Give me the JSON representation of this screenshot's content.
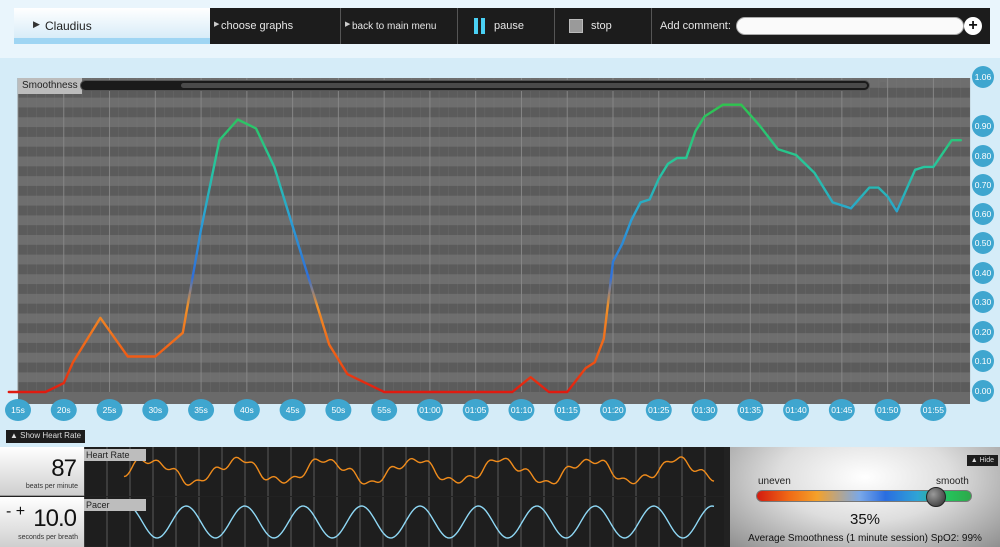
{
  "user": {
    "name": "Claudius"
  },
  "toolbar": {
    "choose_graphs": "choose graphs",
    "back_to_main_menu": "back to main menu",
    "pause": "pause",
    "stop": "stop",
    "add_comment_label": "Add comment:",
    "comment_value": ""
  },
  "chart": {
    "label": "Smoothness",
    "show_heart_rate": "Show Heart Rate"
  },
  "chart_data": {
    "type": "line",
    "xlabel": "",
    "ylabel": "",
    "x_ticks": [
      "15s",
      "20s",
      "25s",
      "30s",
      "35s",
      "40s",
      "45s",
      "50s",
      "55s",
      "01:00",
      "01:05",
      "01:10",
      "01:15",
      "01:20",
      "01:25",
      "01:30",
      "01:35",
      "01:40",
      "01:45",
      "01:50",
      "01:55"
    ],
    "y_ticks": [
      "1.06",
      "0.90",
      "0.80",
      "0.70",
      "0.60",
      "0.50",
      "0.40",
      "0.30",
      "0.20",
      "0.10",
      "0.00"
    ],
    "ylim": [
      0,
      1.06
    ],
    "x_seconds": [
      14,
      18,
      20,
      21,
      24,
      27,
      30,
      33,
      35,
      37,
      39,
      41,
      43,
      45,
      47,
      49,
      51,
      53,
      55,
      57,
      60,
      63,
      66,
      69,
      71,
      73,
      75,
      77,
      78,
      79,
      80,
      81,
      82,
      83,
      84,
      85,
      86,
      87,
      88,
      89,
      90,
      92,
      94,
      96,
      98,
      100,
      102,
      104,
      106,
      108,
      109,
      110,
      111,
      112,
      113,
      114,
      115,
      117,
      118
    ],
    "y": [
      0.0,
      0.0,
      0.03,
      0.1,
      0.25,
      0.12,
      0.12,
      0.2,
      0.55,
      0.85,
      0.92,
      0.89,
      0.76,
      0.56,
      0.36,
      0.16,
      0.06,
      0.03,
      0.0,
      0.0,
      0.0,
      0.0,
      0.0,
      0.0,
      0.05,
      0.0,
      0.0,
      0.08,
      0.1,
      0.18,
      0.44,
      0.5,
      0.58,
      0.64,
      0.65,
      0.72,
      0.77,
      0.79,
      0.79,
      0.88,
      0.93,
      0.97,
      0.97,
      0.9,
      0.82,
      0.8,
      0.74,
      0.64,
      0.62,
      0.69,
      0.69,
      0.66,
      0.61,
      0.68,
      0.75,
      0.76,
      0.76,
      0.85,
      0.85
    ]
  },
  "heart_rate": {
    "label": "Heart Rate",
    "value": "87",
    "unit": "beats per minute"
  },
  "pacer": {
    "label": "Pacer",
    "value": "10.0",
    "controls": "- +",
    "unit": "seconds per breath"
  },
  "meter": {
    "hide": "Hide",
    "uneven": "uneven",
    "smooth": "smooth",
    "percent": "35%",
    "level": 0.86,
    "summary": "Average Smoothness (1 minute session) SpO2: 99%"
  }
}
